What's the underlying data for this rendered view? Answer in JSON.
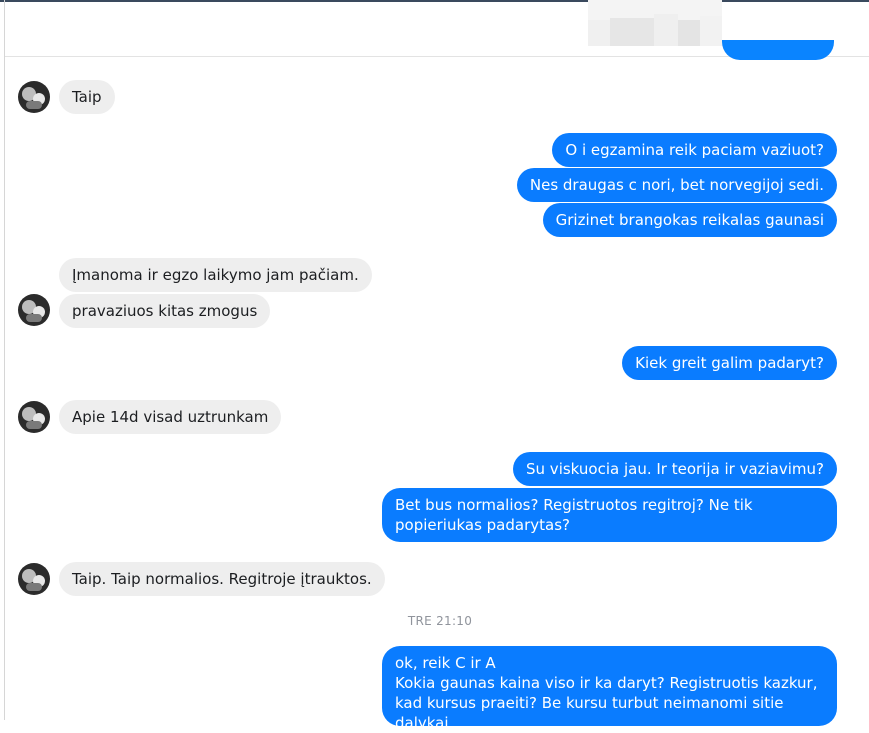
{
  "timestamp": "TRE 21:10",
  "messages": [
    {
      "text": "Taip"
    },
    {
      "text": "O i egzamina reik paciam vaziuot?"
    },
    {
      "text": "Nes draugas c nori, bet norvegijoj sedi."
    },
    {
      "text": "Grizinet brangokas reikalas gaunasi"
    },
    {
      "text": "Įmanoma ir egzo laikymo jam pačiam."
    },
    {
      "text": "pravaziuos kitas zmogus"
    },
    {
      "text": "Kiek greit galim padaryt?"
    },
    {
      "text": "Apie 14d visad uztrunkam"
    },
    {
      "text": "Su viskuocia jau. Ir teorija ir vaziavimu?"
    },
    {
      "text": "Bet bus normalios? Registruotos regitroj? Ne tik popieriukas padarytas?"
    },
    {
      "text": "Taip. Taip normalios. Regitroje įtrauktos."
    },
    {
      "text": "ok, reik C ir A"
    },
    {
      "text": "Kokia gaunas kaina viso ir ka daryt? Registruotis kazkur, kad kursus praeiti? Be kursu turbut neimanomi sitie dalykai"
    }
  ]
}
